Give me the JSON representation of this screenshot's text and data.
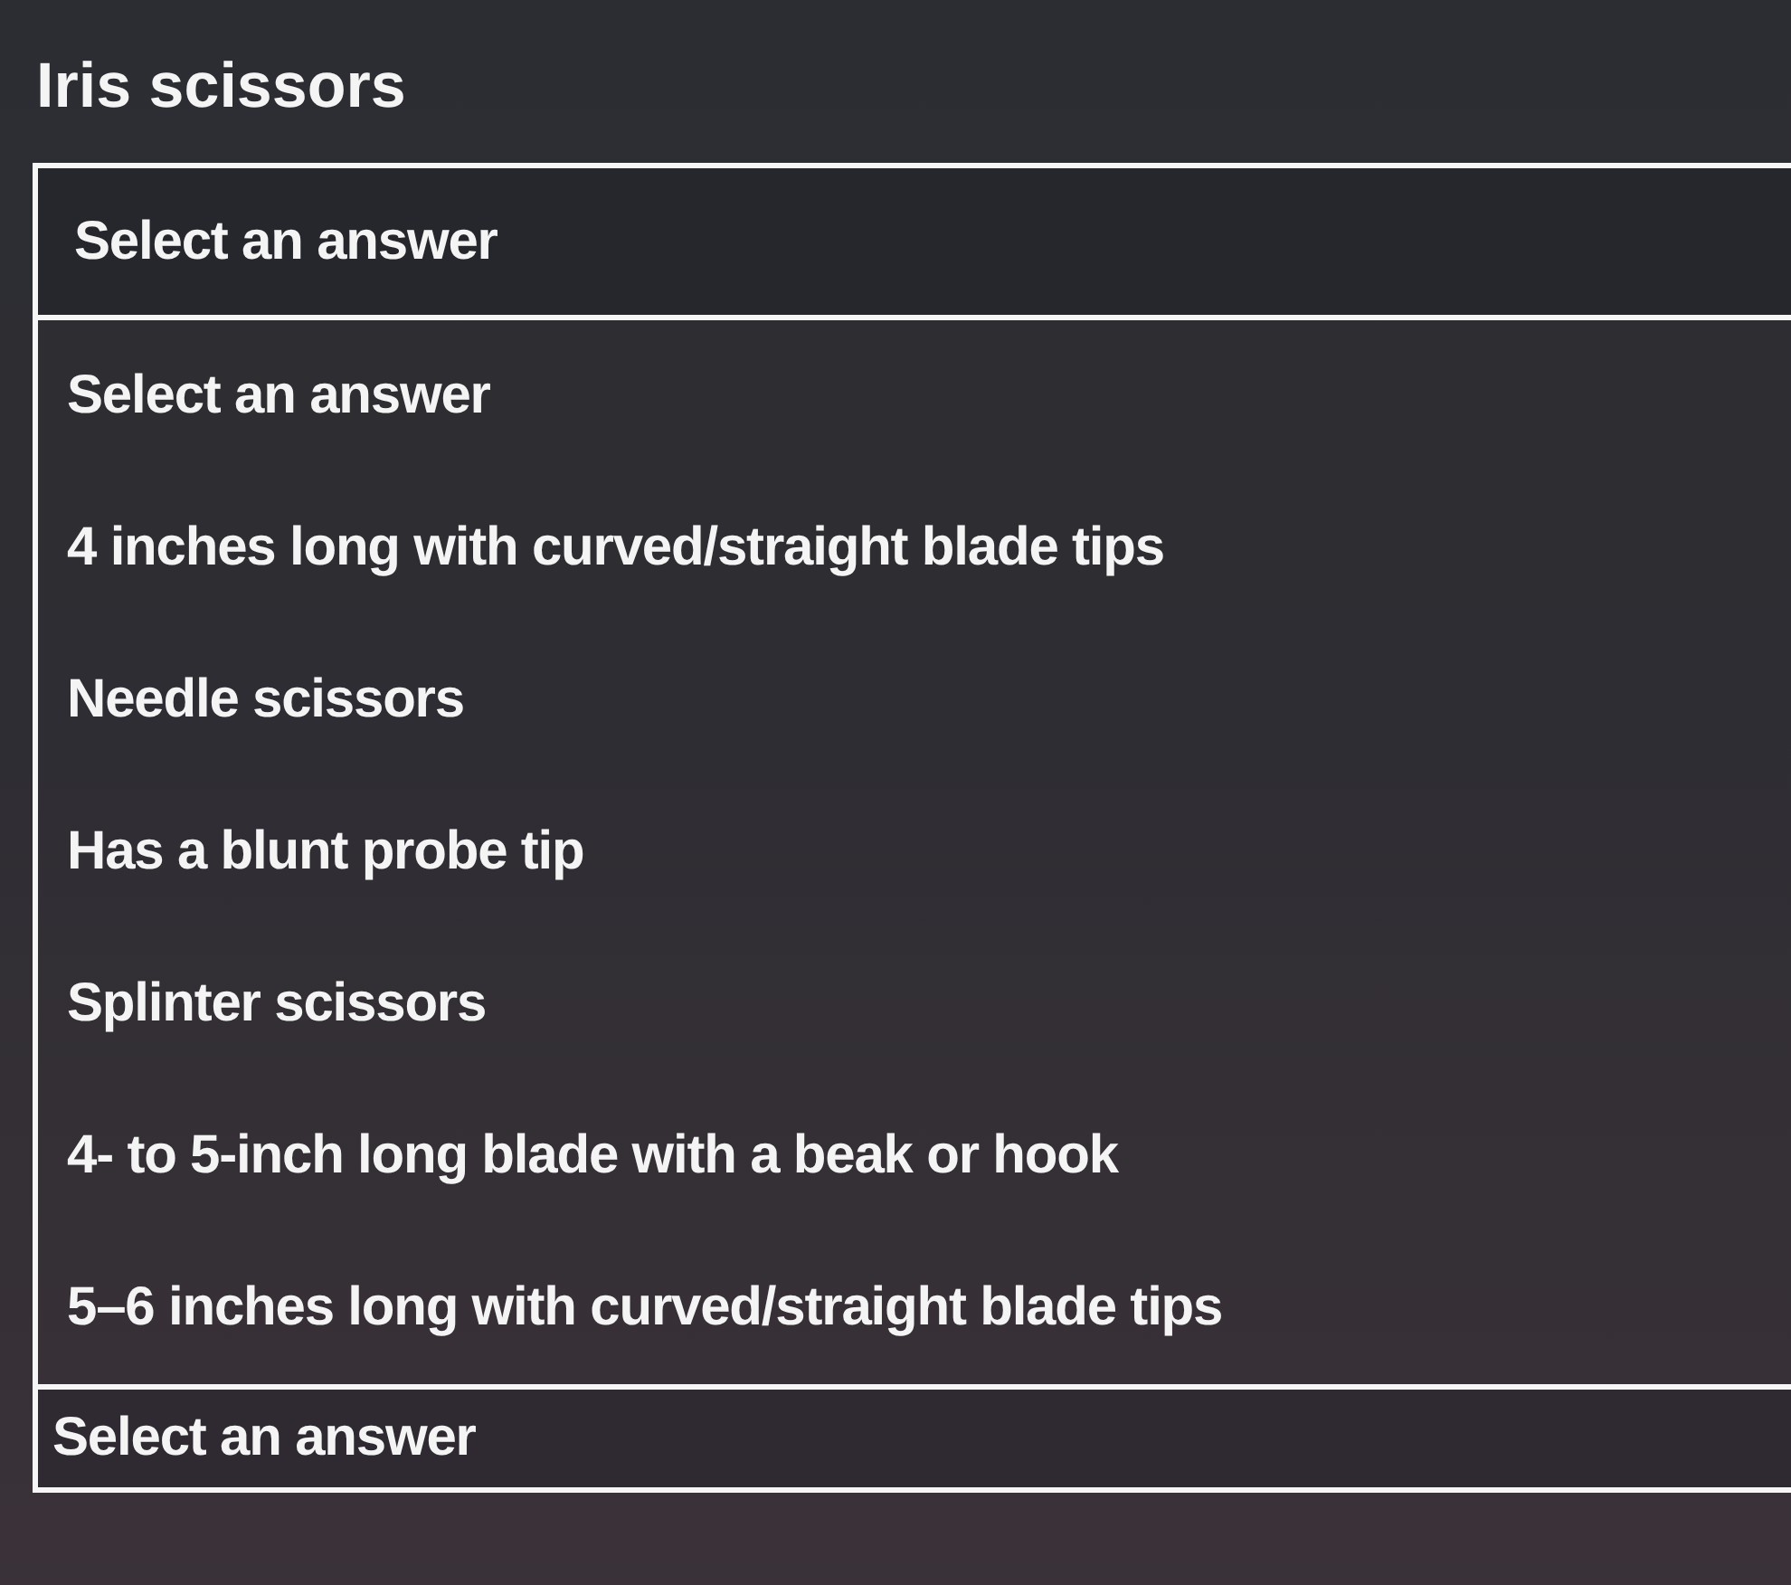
{
  "question": {
    "title": "Iris scissors",
    "select": {
      "value": "Select an answer",
      "expanded": true
    }
  },
  "dropdown": {
    "options": [
      {
        "label": "Select an answer",
        "selected": false
      },
      {
        "label": "4 inches long with curved/straight blade tips",
        "selected": false
      },
      {
        "label": "Needle scissors",
        "selected": false
      },
      {
        "label": "Has a blunt probe tip",
        "selected": false
      },
      {
        "label": "Splinter scissors",
        "selected": false
      },
      {
        "label": "4- to 5-inch long blade with a beak or hook",
        "selected": false
      },
      {
        "label": "5–6 inches long with curved/straight blade tips",
        "selected": false
      }
    ]
  },
  "next_select": {
    "value": "Select an answer"
  }
}
